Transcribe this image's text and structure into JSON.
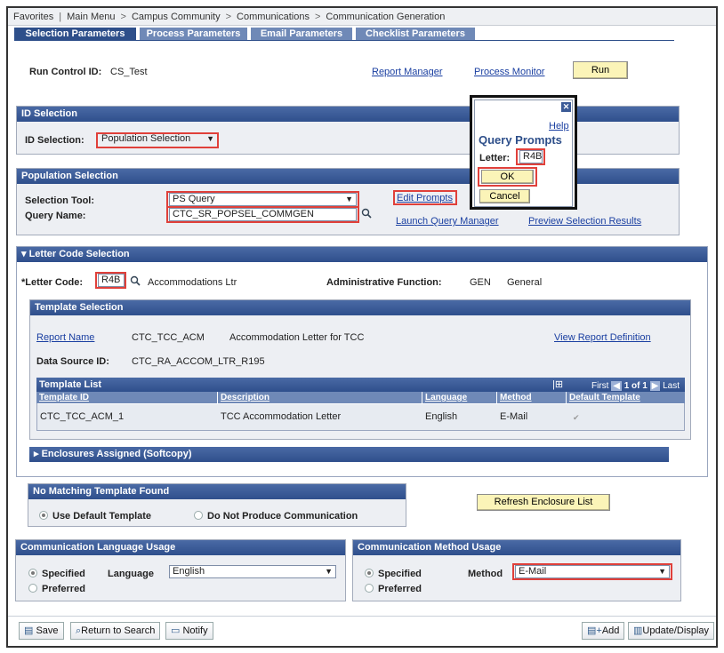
{
  "breadcrumb": [
    "Favorites",
    "Main Menu",
    "Campus Community",
    "Communications",
    "Communication Generation"
  ],
  "tabs": [
    "Selection Parameters",
    "Process Parameters",
    "Email Parameters",
    "Checklist Parameters"
  ],
  "run_control": {
    "label": "Run Control ID:",
    "value": "CS_Test"
  },
  "header_links": {
    "report_manager": "Report Manager",
    "process_monitor": "Process Monitor",
    "run": "Run"
  },
  "id_selection": {
    "title": "ID Selection",
    "label": "ID Selection:",
    "value": "Population Selection"
  },
  "population": {
    "title": "Population Selection",
    "tool_label": "Selection Tool:",
    "tool_value": "PS Query",
    "query_label": "Query Name:",
    "query_value": "CTC_SR_POPSEL_COMMGEN",
    "edit_prompts": "Edit Prompts",
    "launch_query_manager": "Launch Query Manager",
    "preview_results": "Preview Selection Results"
  },
  "query_prompts": {
    "help": "Help",
    "title": "Query Prompts",
    "letter_label": "Letter:",
    "letter_value": "R4B",
    "ok": "OK",
    "cancel": "Cancel"
  },
  "letter_code": {
    "title": "Letter Code Selection",
    "label": "*Letter Code:",
    "value": "R4B",
    "desc": "Accommodations Ltr",
    "admin_label": "Administrative Function:",
    "admin_code": "GEN",
    "admin_desc": "General"
  },
  "template_selection": {
    "title": "Template Selection",
    "report_name_label": "Report Name",
    "report_name_value": "CTC_TCC_ACM",
    "report_desc": "Accommodation Letter for TCC",
    "view_report_def": "View Report Definition",
    "data_source_label": "Data Source ID:",
    "data_source_value": "CTC_RA_ACCOM_LTR_R195"
  },
  "template_list": {
    "title": "Template List",
    "nav_first": "First",
    "nav_count": "1 of 1",
    "nav_last": "Last",
    "columns": [
      "Template ID",
      "Description",
      "Language",
      "Method",
      "Default Template"
    ],
    "rows": [
      {
        "template_id": "CTC_TCC_ACM_1",
        "description": "TCC Accommodation Letter",
        "language": "English",
        "method": "E-Mail",
        "default": true
      }
    ]
  },
  "enclosures": {
    "title": "Enclosures Assigned (Softcopy)"
  },
  "no_match": {
    "title": "No Matching Template Found",
    "opt1": "Use Default Template",
    "opt2": "Do Not Produce Communication",
    "refresh": "Refresh Enclosure List"
  },
  "comm_language": {
    "title": "Communication Language Usage",
    "specified": "Specified",
    "preferred": "Preferred",
    "language_label": "Language",
    "language_value": "English"
  },
  "comm_method": {
    "title": "Communication Method Usage",
    "specified": "Specified",
    "preferred": "Preferred",
    "method_label": "Method",
    "method_value": "E-Mail"
  },
  "toolbar": {
    "save": "Save",
    "return_to_search": "Return to Search",
    "notify": "Notify",
    "add": "Add",
    "update_display": "Update/Display"
  },
  "colors": {
    "header_blue": "#2f4f8c",
    "highlight_red": "#e0403a",
    "button_yellow": "#fbf4b8"
  }
}
